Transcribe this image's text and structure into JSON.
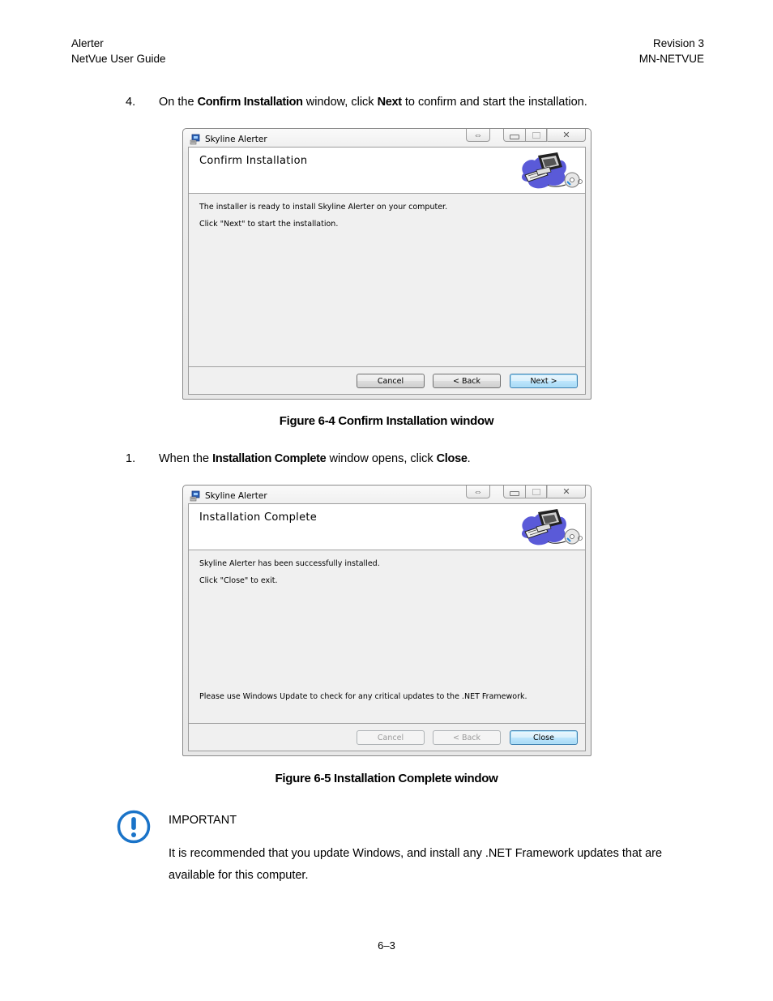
{
  "header": {
    "left_line1": "Alerter",
    "left_line2": "NetVue User Guide",
    "right_line1": "Revision 3",
    "right_line2": "MN-NETVUE"
  },
  "step_confirm": {
    "number": "4.",
    "prefix": "On the ",
    "bold1": "Confirm Installation",
    "middle": " window, click ",
    "bold2": "Next",
    "suffix": " to confirm and start the installation."
  },
  "window_confirm": {
    "title": "Skyline Alerter",
    "banner_title": "Confirm Installation",
    "lines": [
      "The installer is ready to install Skyline Alerter on your computer.",
      "Click \"Next\" to start the installation."
    ],
    "buttons": {
      "cancel": "Cancel",
      "back": "< Back",
      "next": "Next >"
    },
    "controls": {
      "help_glyph": "⇔",
      "close_glyph": "✕"
    }
  },
  "caption_confirm": "Figure 6-4 Confirm Installation window",
  "step_complete": {
    "number": "1.",
    "prefix": "When the ",
    "bold1": "Installation Complete",
    "middle": " window opens, click ",
    "bold2": "Close",
    "suffix": "."
  },
  "window_complete": {
    "title": "Skyline Alerter",
    "banner_title": "Installation Complete",
    "lines": [
      "Skyline Alerter has been successfully installed.",
      "Click \"Close\" to exit."
    ],
    "note": "Please use Windows Update to check for any critical updates to the .NET Framework.",
    "buttons": {
      "cancel": "Cancel",
      "back": "< Back",
      "close": "Close"
    },
    "controls": {
      "help_glyph": "⇔",
      "close_glyph": "✕"
    }
  },
  "caption_complete": "Figure 6-5 Installation Complete window",
  "important": {
    "icon": "exclamation-circle-icon",
    "title": "IMPORTANT",
    "text": "It is recommended that you update Windows, and install any .NET Framework updates that are available for this computer.",
    "color": "#1a73c8"
  },
  "page_number": "6–3"
}
